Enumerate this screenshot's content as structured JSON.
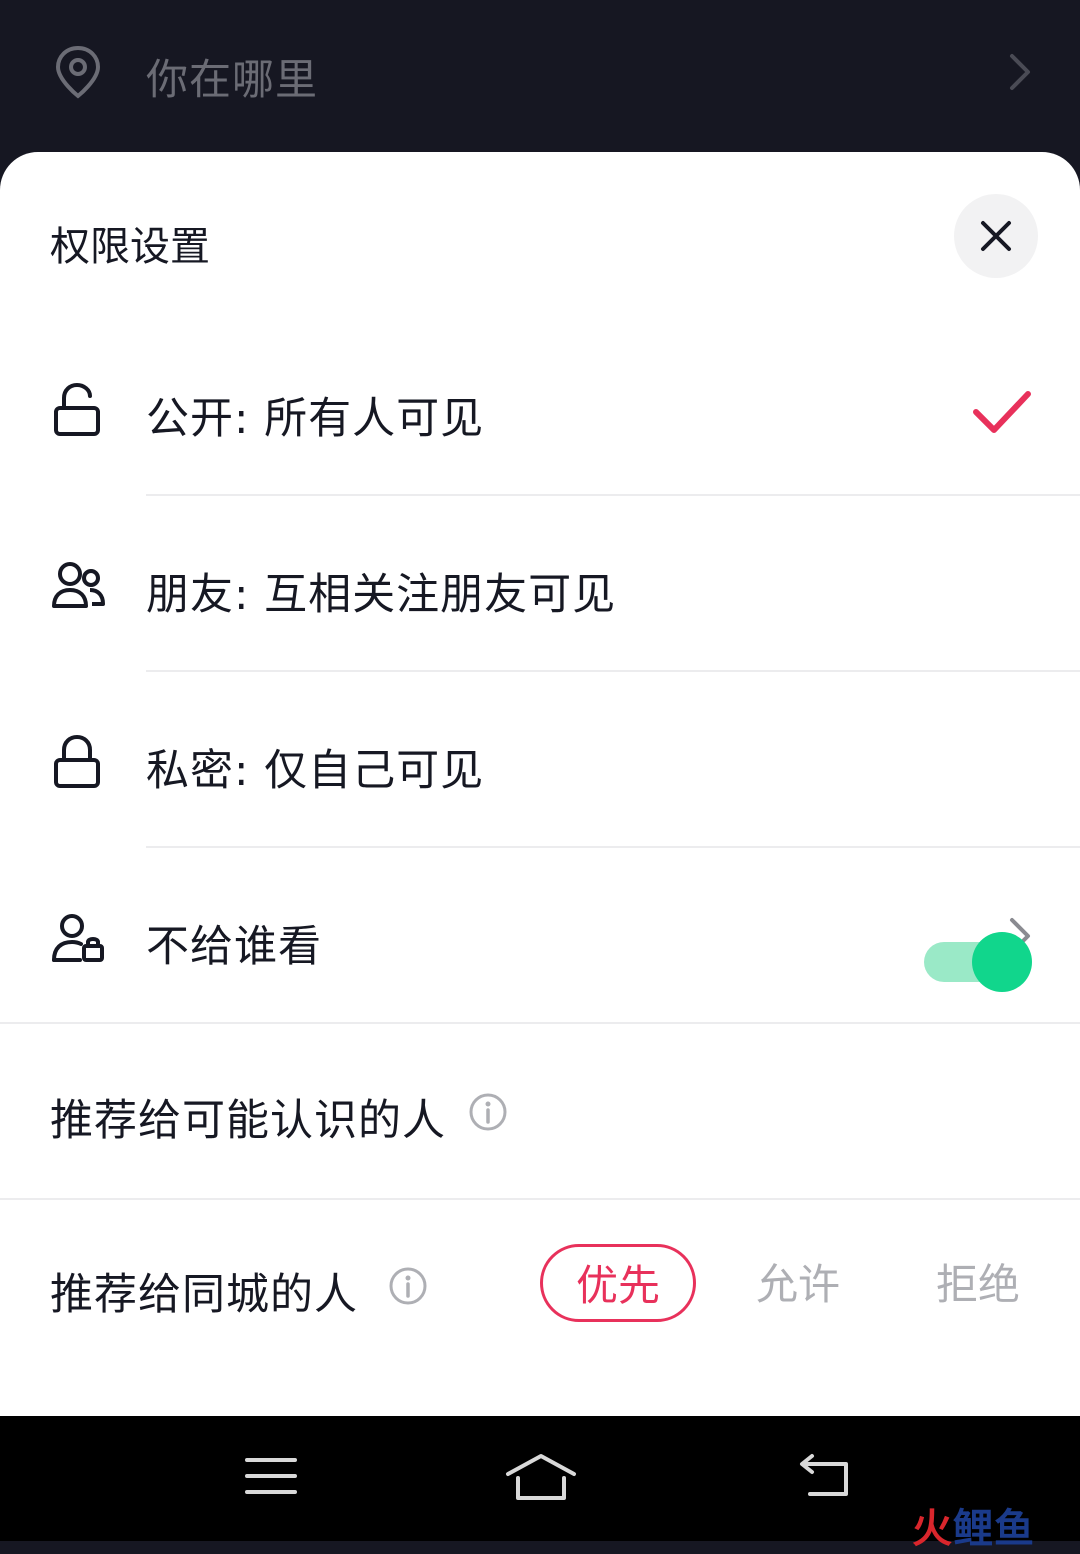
{
  "location_bar": {
    "icon": "location-pin-icon",
    "text": "你在哪里"
  },
  "sheet": {
    "title": "权限设置",
    "options": [
      {
        "icon": "unlock-icon",
        "label": "公开: 所有人可见",
        "selected": true
      },
      {
        "icon": "friends-icon",
        "label": "朋友: 互相关注朋友可见",
        "selected": false
      },
      {
        "icon": "lock-icon",
        "label": "私密: 仅自己可见",
        "selected": false
      },
      {
        "icon": "user-lock-icon",
        "label": "不给谁看",
        "has_chevron": true
      }
    ],
    "recommend_known": {
      "label": "推荐给可能认识的人",
      "toggle_on": true
    },
    "recommend_city": {
      "label": "推荐给同城的人",
      "options": [
        "优先",
        "允许",
        "拒绝"
      ],
      "selected": "优先"
    }
  },
  "colors": {
    "accent": "#e8315b",
    "toggle_on": "#11d68c",
    "dark_bg": "#161722"
  },
  "watermark": {
    "part1": "火",
    "part2": "鲤鱼"
  }
}
